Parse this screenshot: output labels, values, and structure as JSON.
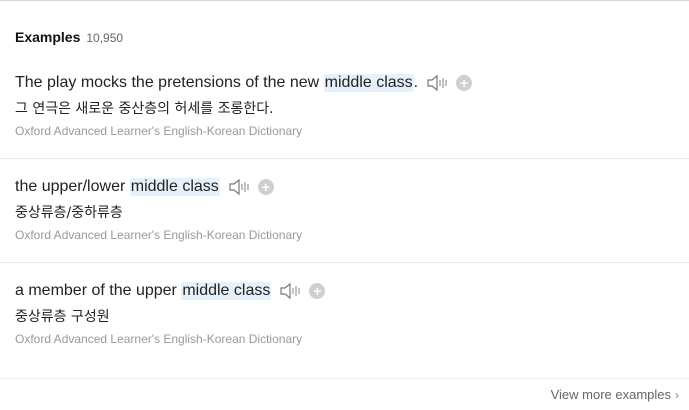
{
  "header": {
    "title": "Examples",
    "count": "10,950"
  },
  "examples": [
    {
      "pre": "The play mocks the pretensions of the new ",
      "highlight": "middle class",
      "post": ".",
      "translation": "그 연극은 새로운 중산층의 허세를 조롱한다.",
      "source": "Oxford Advanced Learner's English-Korean Dictionary"
    },
    {
      "pre": "the upper/lower ",
      "highlight": "middle class",
      "post": "",
      "translation": "중상류층/중하류층",
      "source": "Oxford Advanced Learner's English-Korean Dictionary"
    },
    {
      "pre": "a member of the upper ",
      "highlight": "middle class",
      "post": "",
      "translation": "중상류층 구성원",
      "source": "Oxford Advanced Learner's English-Korean Dictionary"
    }
  ],
  "icons": {
    "audio": "speaker-icon",
    "add": "plus-icon",
    "more": "chevron-right-icon"
  },
  "plus_symbol": "+",
  "footer": {
    "view_more_label": "View more examples",
    "chevron": "›"
  },
  "colors": {
    "highlight": "#e6f1fb",
    "source_text": "#999999"
  }
}
